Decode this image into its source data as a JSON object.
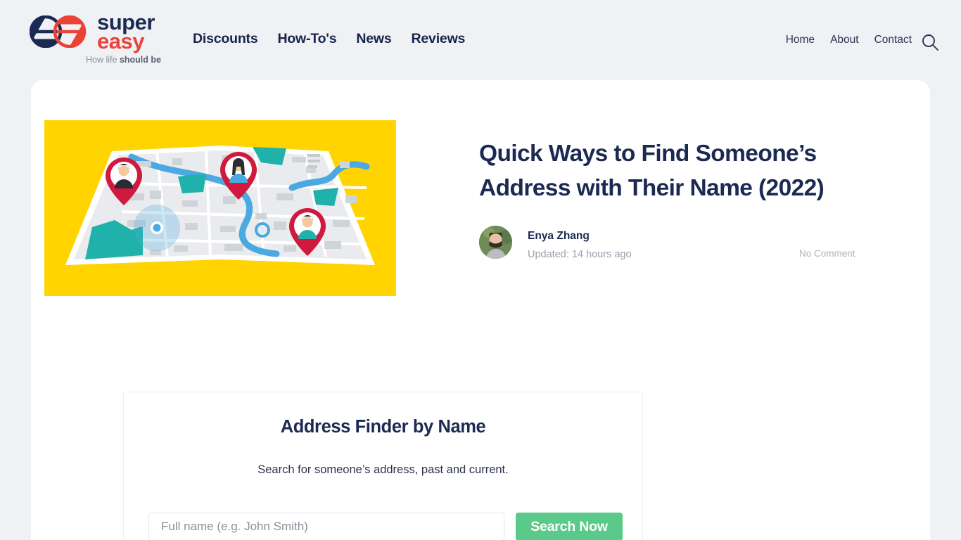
{
  "brand": {
    "name_line1": "super",
    "name_line2": "easy",
    "tagline_prefix": "How life ",
    "tagline_bold": "should be",
    "logo_icon": "superEasy-double-e-logo",
    "navy": "#1b2a52",
    "red": "#ea4335"
  },
  "nav": {
    "primary": [
      {
        "label": "Discounts"
      },
      {
        "label": "How-To's"
      },
      {
        "label": "News"
      },
      {
        "label": "Reviews"
      }
    ],
    "secondary": [
      {
        "label": "Home"
      },
      {
        "label": "About"
      },
      {
        "label": "Contact"
      }
    ],
    "search_icon": "search-icon"
  },
  "article": {
    "title": "Quick Ways to Find Someone’s Address with Their Name (2022)",
    "hero_image_alt": "folded-city-map-with-location-pins",
    "author": "Enya Zhang",
    "updated": "Updated: 14 hours ago",
    "comments": "No Comment"
  },
  "widget": {
    "title": "Address Finder by Name",
    "subtitle": "Search for someone’s address, past and current.",
    "input_value": "",
    "input_placeholder": "Full name (e.g. John Smith)",
    "button_label": "Search Now",
    "button_color": "#5bc98a"
  },
  "theme": {
    "page_bg": "#f0f1f5",
    "card_bg": "#ffffff",
    "hero_bg": "#ffd400",
    "pin_red": "#d01a3d",
    "river_blue": "#4aa9e0",
    "park_teal": "#20b2aa"
  }
}
